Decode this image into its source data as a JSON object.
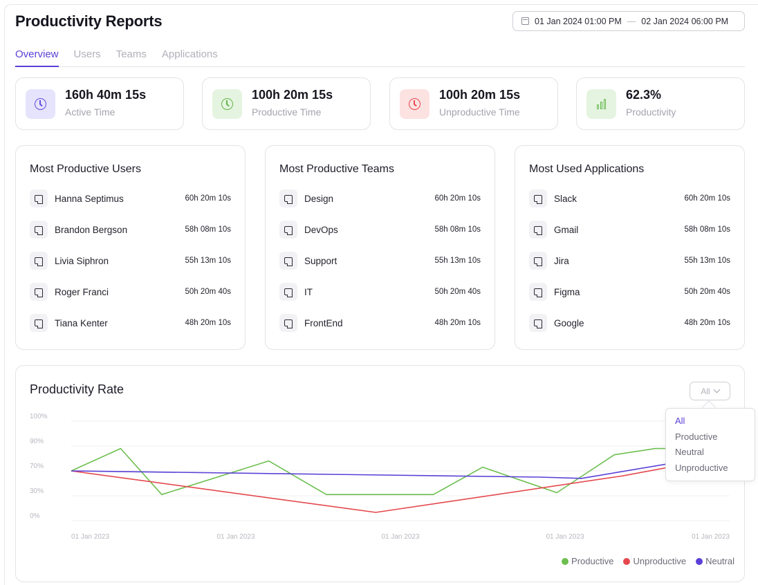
{
  "header": {
    "title": "Productivity Reports",
    "date_start": "01 Jan 2024 01:00 PM",
    "date_separator": "—",
    "date_end": "02 Jan 2024 06:00 PM"
  },
  "tabs": [
    {
      "label": "Overview",
      "active": true
    },
    {
      "label": "Users",
      "active": false
    },
    {
      "label": "Teams",
      "active": false
    },
    {
      "label": "Applications",
      "active": false
    }
  ],
  "stats": [
    {
      "value": "160h 40m 15s",
      "label": "Active Time",
      "icon": "clock-icon",
      "color": "#5b4ee0",
      "bg": "#e6e4fc"
    },
    {
      "value": "100h 20m 15s",
      "label": "Productive Time",
      "icon": "clock-icon",
      "color": "#5fb54a",
      "bg": "#e5f4e0"
    },
    {
      "value": "100h 20m 15s",
      "label": "Unproductive Time",
      "icon": "clock-icon",
      "color": "#e5484d",
      "bg": "#fde2e2"
    },
    {
      "value": "62.3%",
      "label": "Productivity",
      "icon": "bar-chart-icon",
      "color": "#5fb54a",
      "bg": "#e5f4e0"
    }
  ],
  "cards": [
    {
      "title": "Most Productive Users",
      "rows": [
        {
          "name": "Hanna Septimus",
          "time": "60h 20m 10s"
        },
        {
          "name": "Brandon Bergson",
          "time": "58h 08m 10s"
        },
        {
          "name": "Livia Siphron",
          "time": "55h 13m 10s"
        },
        {
          "name": "Roger Franci",
          "time": "50h 20m 40s"
        },
        {
          "name": "Tiana Kenter",
          "time": "48h 20m 10s"
        }
      ]
    },
    {
      "title": "Most Productive Teams",
      "rows": [
        {
          "name": "Design",
          "time": "60h 20m 10s"
        },
        {
          "name": "DevOps",
          "time": "58h 08m 10s"
        },
        {
          "name": "Support",
          "time": "55h 13m 10s"
        },
        {
          "name": "IT",
          "time": "50h 20m 40s"
        },
        {
          "name": "FrontEnd",
          "time": "48h 20m 10s"
        }
      ]
    },
    {
      "title": "Most Used Applications",
      "rows": [
        {
          "name": "Slack",
          "time": "60h 20m 10s"
        },
        {
          "name": "Gmail",
          "time": "58h 08m 10s"
        },
        {
          "name": "Jira",
          "time": "55h 13m 10s"
        },
        {
          "name": "Figma",
          "time": "50h 20m 40s"
        },
        {
          "name": "Google",
          "time": "48h 20m 10s"
        }
      ]
    }
  ],
  "productivity": {
    "title": "Productivity Rate",
    "filter_value": "All",
    "filter_options": [
      "All",
      "Productive",
      "Neutral",
      "Unproductive"
    ],
    "selected_option": "All"
  },
  "chart_data": {
    "type": "line",
    "title": "Productivity Rate",
    "xlabel": "",
    "ylabel": "",
    "y_ticks": [
      "100%",
      "90%",
      "70%",
      "30%",
      "0%"
    ],
    "x_tick_labels": [
      "01 Jan 2023",
      "01 Jan 2023",
      "01 Jan 2023",
      "01 Jan 2023",
      "01 Jan 2023"
    ],
    "y_tick_levels": [
      100,
      90,
      70,
      30,
      0
    ],
    "x_domain": [
      0,
      8
    ],
    "grid": true,
    "legend_position": "bottom-right",
    "series": [
      {
        "name": "Productive",
        "color": "#6cbf4f",
        "x": [
          0,
          0.6,
          1.1,
          2.4,
          3.1,
          4.4,
          5,
          5.9,
          6.6,
          7.1,
          8
        ],
        "y": [
          70,
          88,
          32,
          78,
          32,
          32,
          73,
          35,
          83,
          88,
          88
        ]
      },
      {
        "name": "Unproductive",
        "color": "#e5484d",
        "x": [
          0,
          3.7,
          6.7,
          8
        ],
        "y": [
          70,
          10,
          62,
          82
        ]
      },
      {
        "name": "Neutral",
        "color": "#5b3fd6",
        "x": [
          0,
          5.7,
          6.2,
          8
        ],
        "y": [
          70,
          60,
          58,
          84
        ]
      }
    ]
  }
}
